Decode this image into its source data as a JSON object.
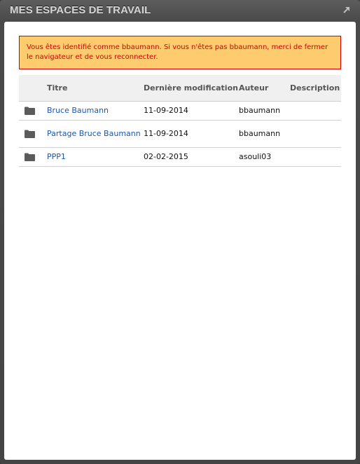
{
  "portlet": {
    "title": "MES ESPACES DE TRAVAIL",
    "expand_icon": "expand-arrow-icon"
  },
  "alert": {
    "message": "Vous êtes identifié comme bbaumann. Si vous n'êtes pas bbaumann, merci de fermer le navigateur et de vous reconnecter.",
    "bg_color": "#fecb6f",
    "text_color": "#d40000"
  },
  "table": {
    "headers": {
      "title": "Titre",
      "modified": "Dernière modification",
      "author": "Auteur",
      "description": "Description"
    },
    "rows": [
      {
        "icon": "folder-icon",
        "title": "Bruce Baumann",
        "modified": "11-09-2014",
        "author": "bbaumann",
        "description": ""
      },
      {
        "icon": "folder-icon",
        "title": "Partage Bruce Baumann",
        "modified": "11-09-2014",
        "author": "bbaumann",
        "description": ""
      },
      {
        "icon": "folder-icon",
        "title": "PPP1",
        "modified": "02-02-2015",
        "author": "asouli03",
        "description": ""
      }
    ]
  }
}
